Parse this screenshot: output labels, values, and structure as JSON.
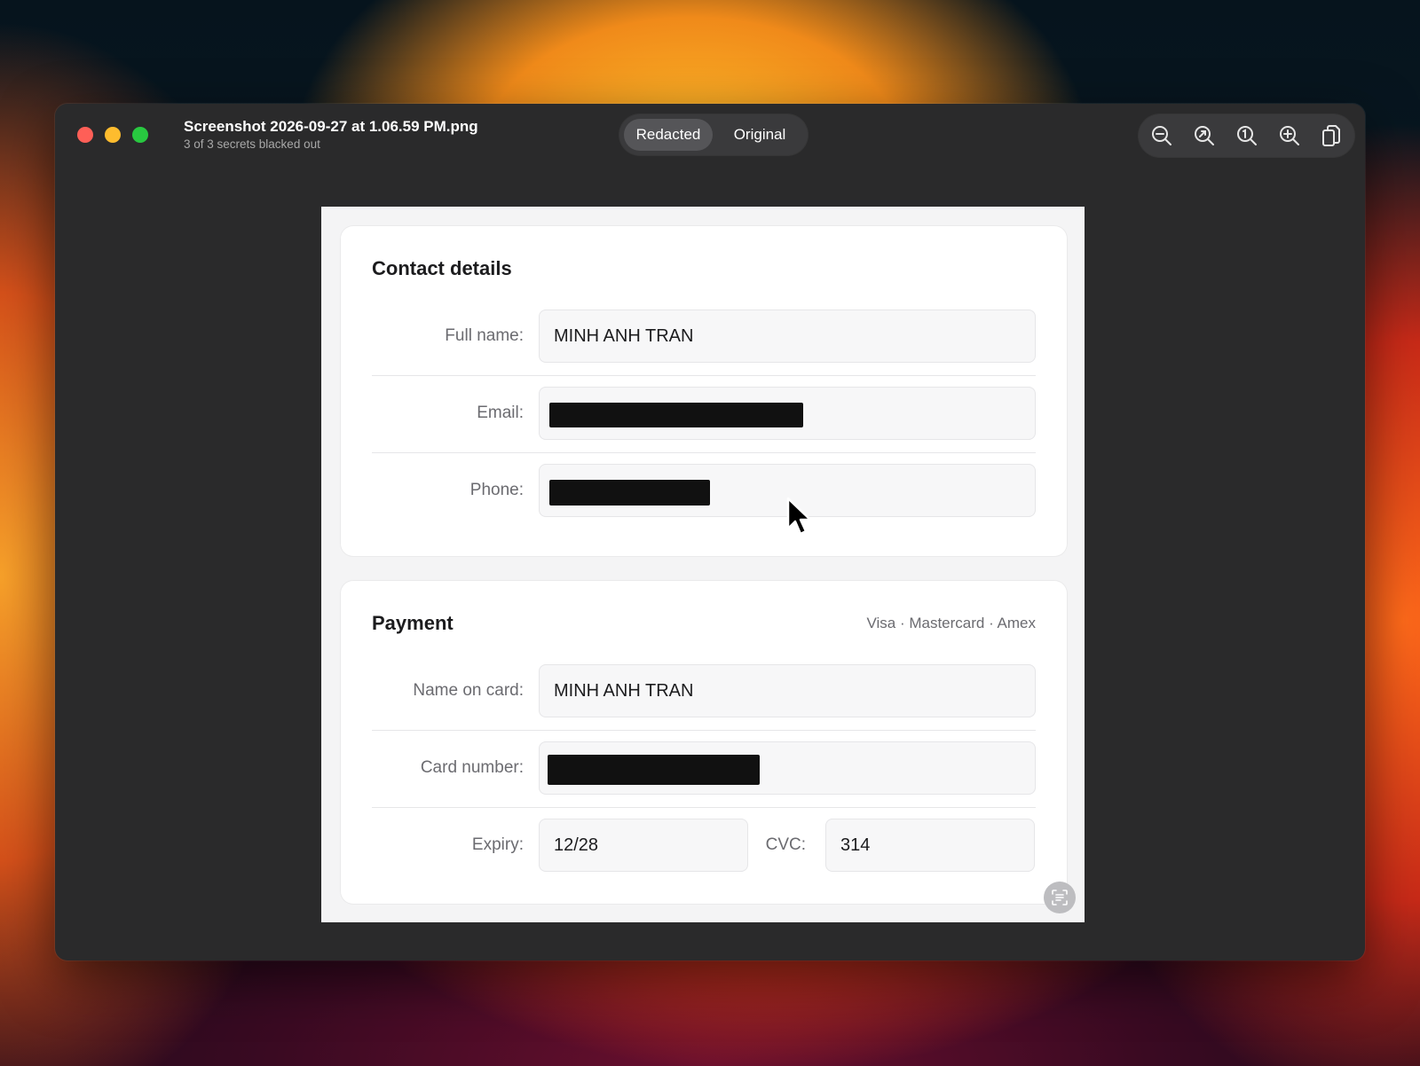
{
  "window": {
    "title": "Screenshot 2026-09-27 at 1.06.59 PM.png",
    "subtitle": "3 of 3 secrets blacked out",
    "segments": [
      {
        "label": "Redacted",
        "selected": true
      },
      {
        "label": "Original",
        "selected": false
      }
    ],
    "toolbar_icons": [
      "zoom-out-icon",
      "zoom-to-fit-icon",
      "actual-size-icon",
      "zoom-in-icon",
      "copy-icon"
    ]
  },
  "contact": {
    "title": "Contact details",
    "full_name_label": "Full name:",
    "full_name_value": "MINH ANH TRAN",
    "email_label": "Email:",
    "phone_label": "Phone:"
  },
  "payment": {
    "title": "Payment",
    "brands": "Visa · Mastercard · Amex",
    "name_label": "Name on card:",
    "name_value": "MINH ANH TRAN",
    "card_label": "Card number:",
    "expiry_label": "Expiry:",
    "expiry_value": "12/28",
    "cvc_label": "CVC:",
    "cvc_value": "314"
  },
  "colors": {
    "redaction": "#111111",
    "close": "#fe5f57",
    "minimize": "#febc2e",
    "maximize": "#28c840"
  }
}
